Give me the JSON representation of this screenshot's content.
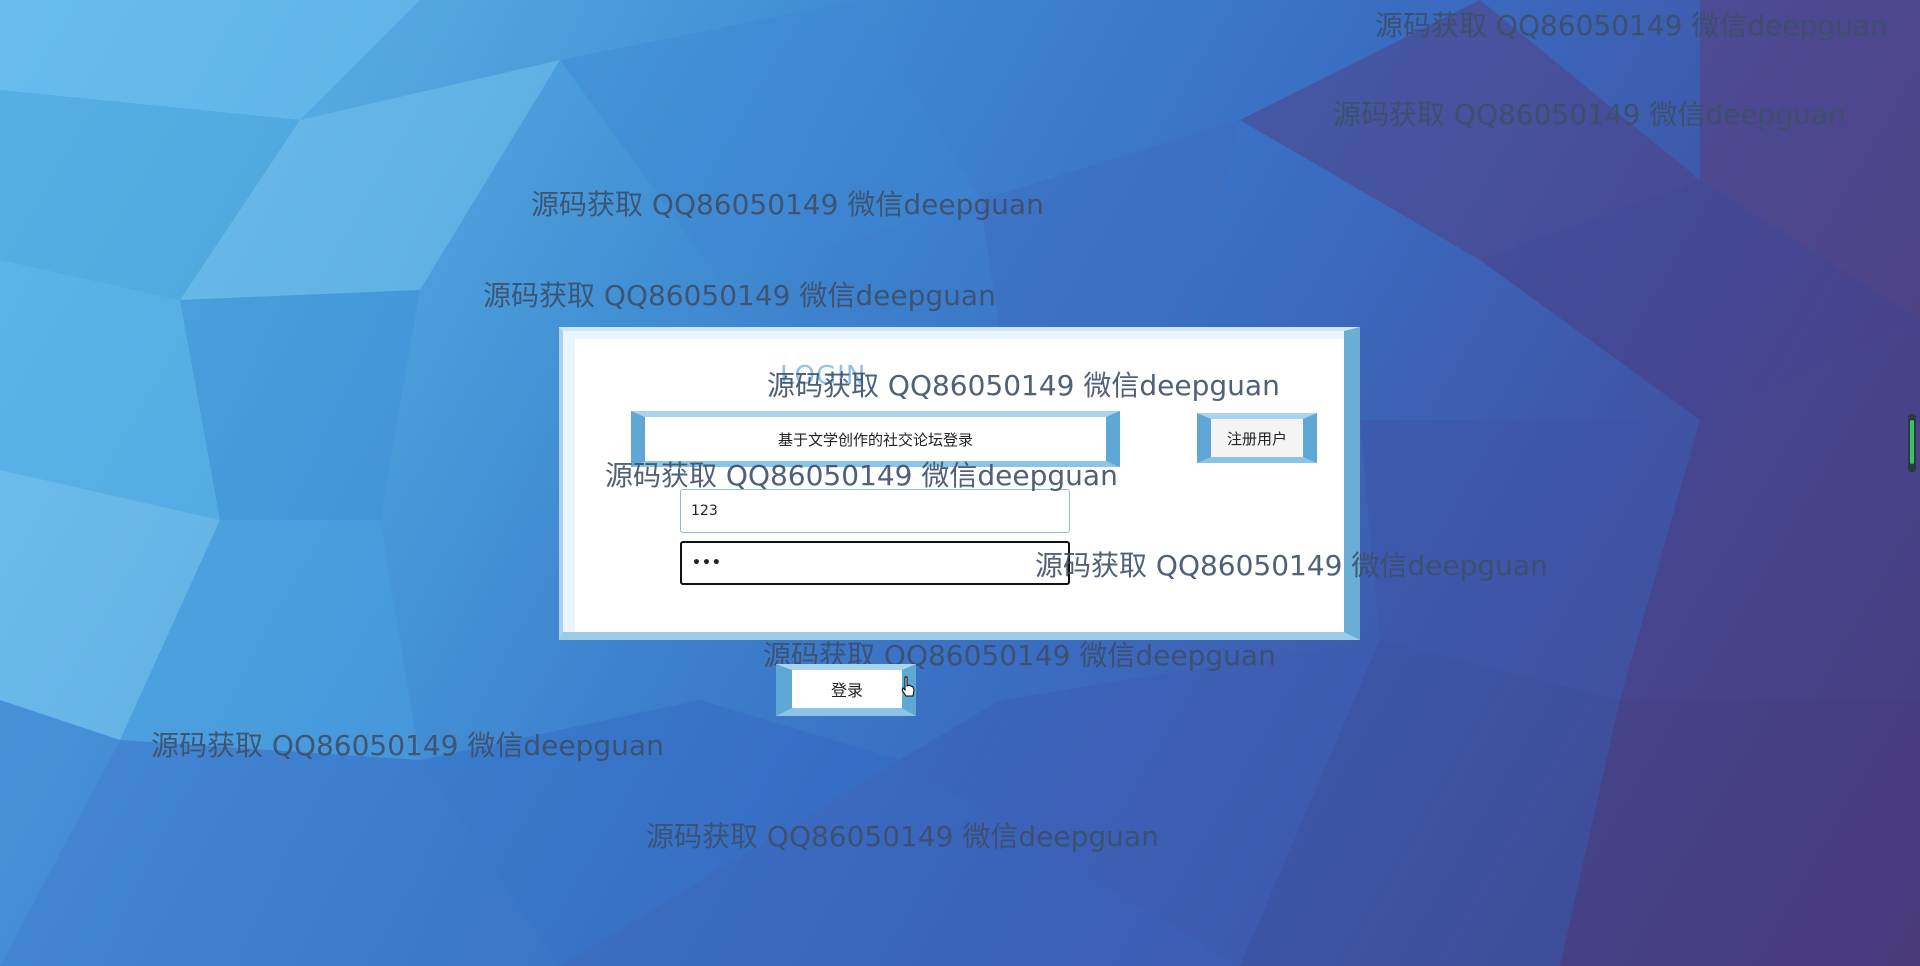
{
  "watermark_text": "源码获取 QQ86050149 微信deepguan",
  "login_panel": {
    "title": "LOGIN",
    "site_title": "基于文学创作的社交论坛登录",
    "register_button": "注册用户",
    "username_value": "123",
    "password_value": "•••"
  },
  "login_button": "登录"
}
